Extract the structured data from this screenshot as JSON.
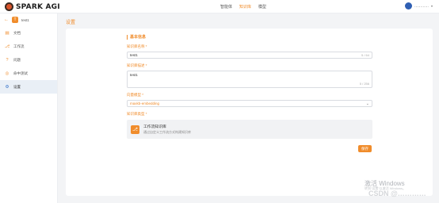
{
  "app": {
    "logo_text": "SPARK AGI"
  },
  "nav": [
    "智能体",
    "知识库",
    "模型"
  ],
  "user": {
    "name": "…………"
  },
  "sidebar": {
    "project_badge": "T",
    "project_name": "test1",
    "items": [
      {
        "label": "文档",
        "icon": "document-icon"
      },
      {
        "label": "工作流",
        "icon": "workflow-icon"
      },
      {
        "label": "问题",
        "icon": "question-icon"
      },
      {
        "label": "命中测试",
        "icon": "target-icon"
      },
      {
        "label": "设置",
        "icon": "gear-icon"
      }
    ]
  },
  "page": {
    "title": "设置"
  },
  "form": {
    "section_title": "基本信息",
    "name_label": "知识库名称",
    "name_value": "test1",
    "name_counter": "5 / 64",
    "desc_label": "知识库描述",
    "desc_value": "test1",
    "desc_counter": "5 / 256",
    "model_label": "向量模型",
    "model_value": "maxkb-embedding",
    "type_label": "知识库类型",
    "type_title": "工作流知识库",
    "type_desc": "通过自定义工作流方式构建知识库",
    "save_label": "保存"
  },
  "watermark": {
    "line1": "激活 Windows",
    "line2": "转到“设置”以激活 Windows。",
    "line3": "CSDN @…………"
  },
  "colors": {
    "accent": "#f08c2b",
    "active_bg": "#e9eff6",
    "page_bg": "#f3f4f6"
  }
}
